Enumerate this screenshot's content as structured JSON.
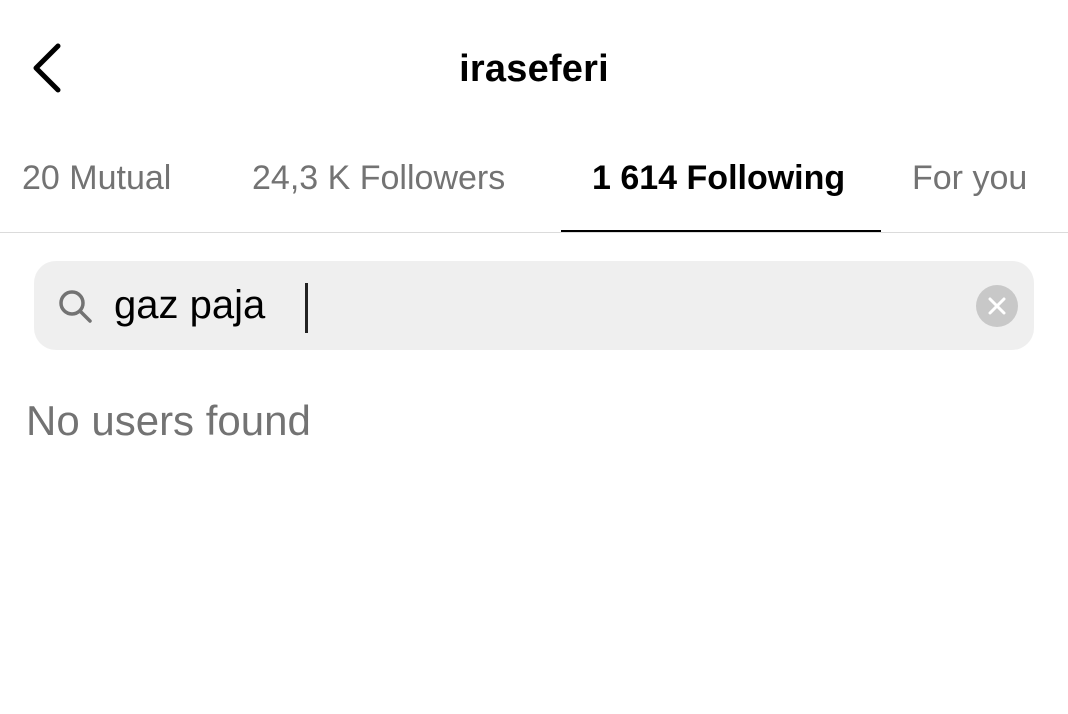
{
  "header": {
    "title": "iraseferi",
    "back_icon": "chevron-left-icon"
  },
  "tabs": [
    {
      "label": "20 Mutual",
      "active": false
    },
    {
      "label": "24,3 K Followers",
      "active": false
    },
    {
      "label": "1 614 Following",
      "active": true
    },
    {
      "label": "For you",
      "active": false
    }
  ],
  "search": {
    "value": "gaz paja",
    "icon": "search-icon",
    "clear_icon": "clear-icon"
  },
  "results": {
    "empty_message": "No users found"
  },
  "colors": {
    "text_primary": "#000000",
    "text_secondary": "#737373",
    "search_bg": "#efefef",
    "divider": "#dbdbdb"
  }
}
